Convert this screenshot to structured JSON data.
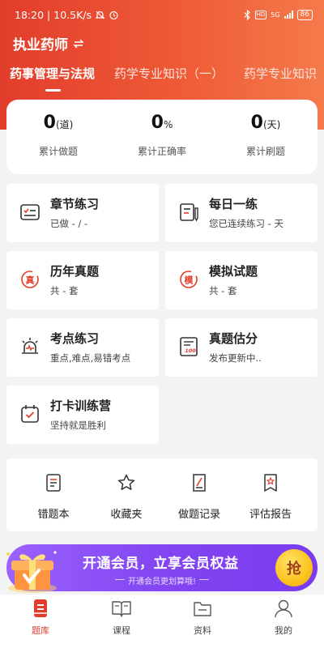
{
  "status_bar": {
    "time": "18:20",
    "speed": "10.5K/s",
    "network": "5G",
    "battery": "86"
  },
  "header": {
    "title": "执业药师",
    "switch_icon": "swap-icon",
    "tabs": [
      "药事管理与法规",
      "药学专业知识（一）",
      "药学专业知识"
    ],
    "active_tab": 0
  },
  "stats": [
    {
      "value": "0",
      "unit": "(道)",
      "label": "累计做题"
    },
    {
      "value": "0",
      "unit": "%",
      "label": "累计正确率"
    },
    {
      "value": "0",
      "unit": "(天)",
      "label": "累计刷题"
    }
  ],
  "cards": [
    {
      "title": "章节练习",
      "sub": "已做 - / -",
      "icon": "chapter-practice-icon"
    },
    {
      "title": "每日一练",
      "sub": "您已连续练习 - 天",
      "icon": "daily-practice-icon"
    },
    {
      "title": "历年真题",
      "sub": "共 - 套",
      "icon": "past-exam-icon",
      "badge": "真"
    },
    {
      "title": "模拟试题",
      "sub": "共 - 套",
      "icon": "mock-exam-icon",
      "badge": "模"
    },
    {
      "title": "考点练习",
      "sub": "重点,难点,易错考点",
      "icon": "keypoint-practice-icon"
    },
    {
      "title": "真题估分",
      "sub": "发布更新中..",
      "icon": "score-estimate-icon",
      "badge": "100"
    },
    {
      "title": "打卡训练营",
      "sub": "坚持就是胜利",
      "icon": "checkin-camp-icon"
    }
  ],
  "tools": [
    {
      "label": "错题本",
      "icon": "wrong-book-icon"
    },
    {
      "label": "收藏夹",
      "icon": "favorites-star-icon"
    },
    {
      "label": "做题记录",
      "icon": "practice-record-icon"
    },
    {
      "label": "评估报告",
      "icon": "assessment-report-icon"
    }
  ],
  "banner": {
    "title": "开通会员，立享会员权益",
    "subtitle": "开通会员更划算哦!",
    "button": "抢"
  },
  "bottom_nav": {
    "items": [
      {
        "label": "题库",
        "icon": "question-bank-icon"
      },
      {
        "label": "课程",
        "icon": "course-book-icon"
      },
      {
        "label": "资料",
        "icon": "folder-icon"
      },
      {
        "label": "我的",
        "icon": "profile-icon"
      }
    ],
    "active": 0
  },
  "colors": {
    "primary": "#e23d2c",
    "banner": "#8245f0",
    "gold": "#fbc21c"
  }
}
